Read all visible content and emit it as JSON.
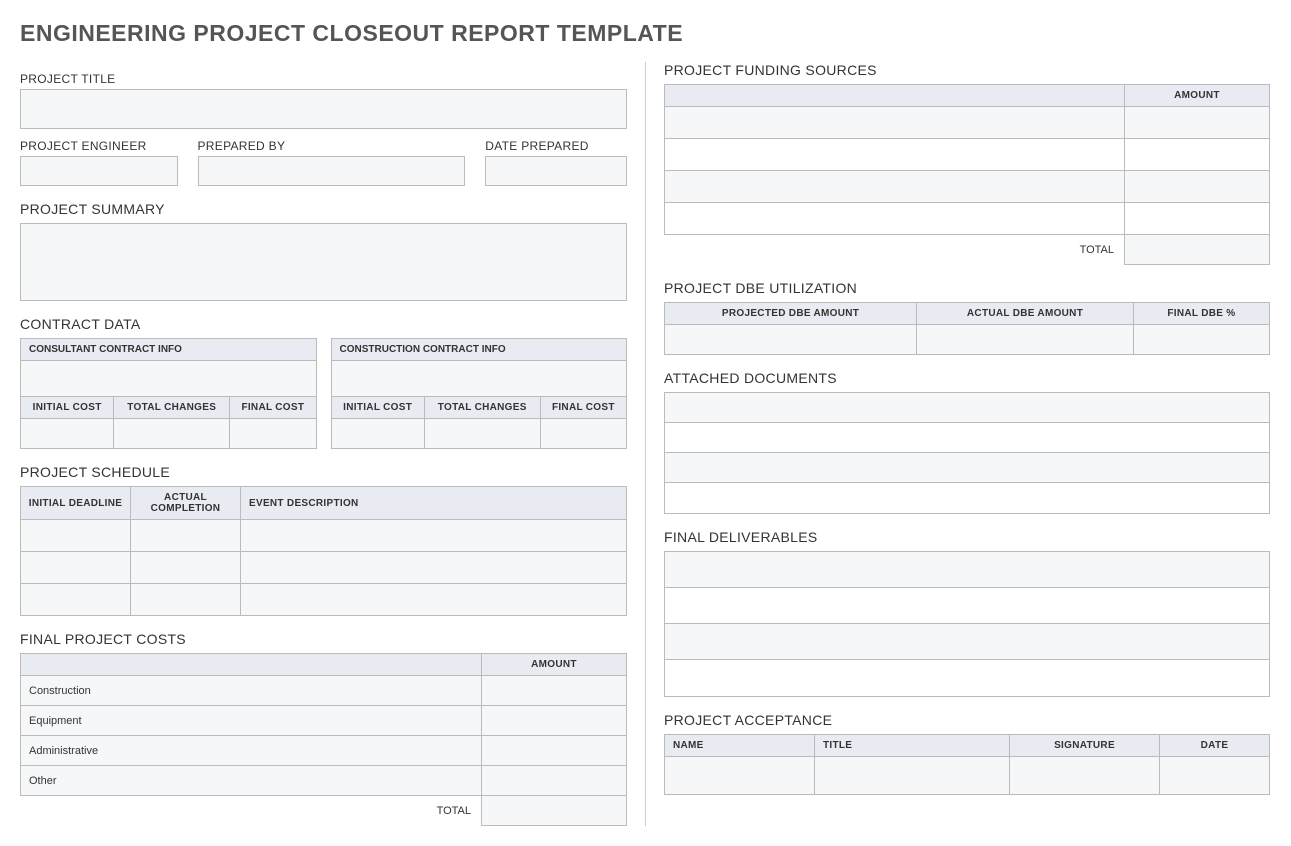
{
  "title": "ENGINEERING PROJECT CLOSEOUT REPORT TEMPLATE",
  "labels": {
    "project_title": "PROJECT TITLE",
    "project_engineer": "PROJECT ENGINEER",
    "prepared_by": "PREPARED BY",
    "date_prepared": "DATE PREPARED",
    "project_summary": "PROJECT SUMMARY",
    "contract_data": "CONTRACT DATA",
    "consultant_info": "CONSULTANT CONTRACT INFO",
    "construction_info": "CONSTRUCTION CONTRACT INFO",
    "initial_cost": "INITIAL COST",
    "total_changes": "TOTAL CHANGES",
    "final_cost": "FINAL COST",
    "project_schedule": "PROJECT SCHEDULE",
    "initial_deadline": "INITIAL DEADLINE",
    "actual_completion": "ACTUAL COMPLETION",
    "event_description": "EVENT DESCRIPTION",
    "final_project_costs": "FINAL PROJECT COSTS",
    "amount": "AMOUNT",
    "total": "TOTAL",
    "project_funding_sources": "PROJECT FUNDING SOURCES",
    "project_dbe": "PROJECT DBE UTILIZATION",
    "projected_dbe": "PROJECTED DBE AMOUNT",
    "actual_dbe": "ACTUAL DBE AMOUNT",
    "final_dbe_pct": "FINAL DBE %",
    "attached_documents": "ATTACHED DOCUMENTS",
    "final_deliverables": "FINAL DELIVERABLES",
    "project_acceptance": "PROJECT ACCEPTANCE",
    "name": "NAME",
    "title_col": "TITLE",
    "signature": "SIGNATURE",
    "date": "DATE"
  },
  "final_costs_rows": [
    "Construction",
    "Equipment",
    "Administrative",
    "Other"
  ]
}
